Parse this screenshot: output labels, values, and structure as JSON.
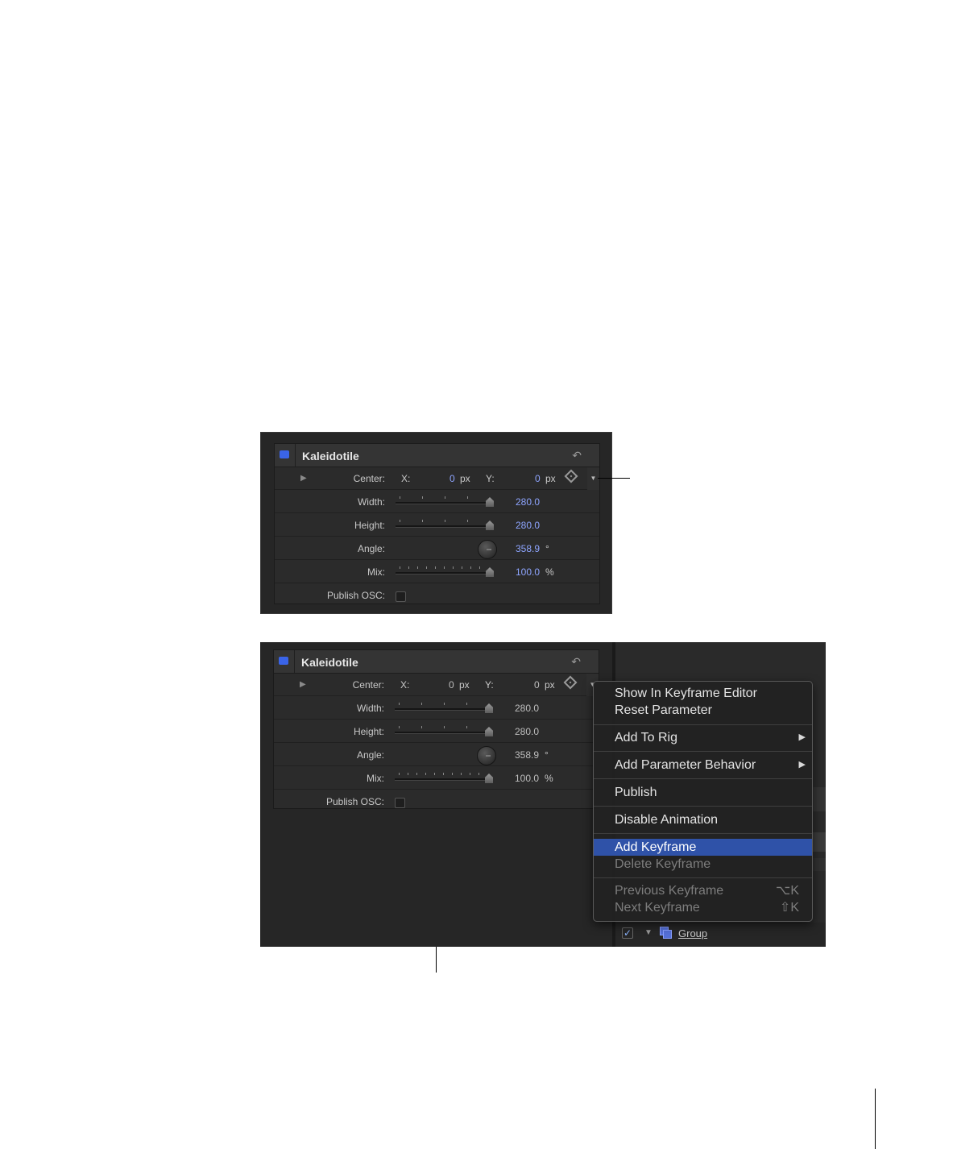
{
  "panel_top": {
    "title": "Kaleidotile",
    "center_label": "Center:",
    "x_label": "X:",
    "x_value": "0",
    "x_unit": "px",
    "y_label": "Y:",
    "y_value": "0",
    "y_unit": "px",
    "width_label": "Width:",
    "width_value": "280.0",
    "height_label": "Height:",
    "height_value": "280.0",
    "angle_label": "Angle:",
    "angle_value": "358.9",
    "angle_unit": "°",
    "mix_label": "Mix:",
    "mix_value": "100.0",
    "mix_unit": "%",
    "publish_label": "Publish OSC:",
    "value_color": "#8ea5ff"
  },
  "panel_bottom": {
    "title": "Kaleidotile",
    "center_label": "Center:",
    "x_label": "X:",
    "x_value": "0",
    "x_unit": "px",
    "y_label": "Y:",
    "y_value": "0",
    "y_unit": "px",
    "width_label": "Width:",
    "width_value": "280.0",
    "height_label": "Height:",
    "height_value": "280.0",
    "angle_label": "Angle:",
    "angle_value": "358.9",
    "angle_unit": "°",
    "mix_label": "Mix:",
    "mix_value": "100.0",
    "mix_unit": "%",
    "publish_label": "Publish OSC:"
  },
  "context_menu": {
    "show_keyframe_editor": "Show In Keyframe Editor",
    "reset_parameter": "Reset Parameter",
    "add_to_rig": "Add To Rig",
    "add_parameter_behavior": "Add Parameter Behavior",
    "publish": "Publish",
    "disable_animation": "Disable Animation",
    "add_keyframe": "Add Keyframe",
    "delete_keyframe": "Delete Keyframe",
    "previous_keyframe": "Previous Keyframe",
    "previous_shortcut": "⌥K",
    "next_keyframe": "Next Keyframe",
    "next_shortcut": "⇧K",
    "highlight_color": "#2f52a8"
  },
  "layers": {
    "group_name": "Group",
    "checkmark": "✓"
  },
  "icons": {
    "enable": "enable-checkbox-icon",
    "reset": "reset-arrow-icon",
    "keyframe": "keyframe-diamond-icon",
    "animation_menu": "animation-menu-icon",
    "disclosure": "disclosure-triangle-icon",
    "submenu": "submenu-arrow-icon",
    "group": "group-layer-icon"
  }
}
